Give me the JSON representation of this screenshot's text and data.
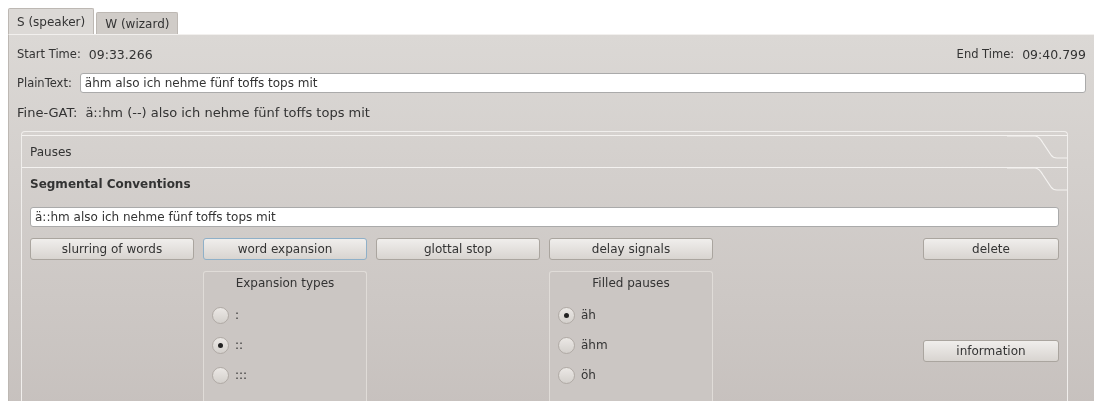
{
  "tabs": [
    {
      "label": "S (speaker)",
      "selected": true
    },
    {
      "label": "W (wizard)",
      "selected": false
    }
  ],
  "start_time": {
    "label": "Start Time:",
    "value": "09:33.266"
  },
  "end_time": {
    "label": "End Time:",
    "value": "09:40.799"
  },
  "plain_text": {
    "label": "PlainText:",
    "value": "ähm also ich nehme fünf toffs tops mit"
  },
  "fine_gat": {
    "label": "Fine-GAT:",
    "value": "ä::hm (--) also ich nehme fünf toffs tops mit"
  },
  "toolbox": {
    "sections": [
      {
        "title": "Pauses",
        "expanded": false
      },
      {
        "title": "Segmental Conventions",
        "expanded": true
      }
    ],
    "editor": {
      "value": "ä::hm also ich nehme fünf toffs tops mit"
    },
    "buttons": [
      {
        "label": "slurring of words",
        "focused": false
      },
      {
        "label": "word expansion",
        "focused": true
      },
      {
        "label": "glottal stop",
        "focused": false
      },
      {
        "label": "delay signals",
        "focused": false
      }
    ],
    "delete_button": {
      "label": "delete"
    },
    "information_button": {
      "label": "information"
    },
    "groups": [
      {
        "title": "Expansion types",
        "options": [
          {
            "label": ":",
            "selected": false
          },
          {
            "label": "::",
            "selected": true
          },
          {
            "label": ":::",
            "selected": false
          }
        ]
      },
      {
        "title": "Filled pauses",
        "options": [
          {
            "label": "äh",
            "selected": true
          },
          {
            "label": "ähm",
            "selected": false
          },
          {
            "label": "öh",
            "selected": false
          }
        ]
      }
    ]
  }
}
